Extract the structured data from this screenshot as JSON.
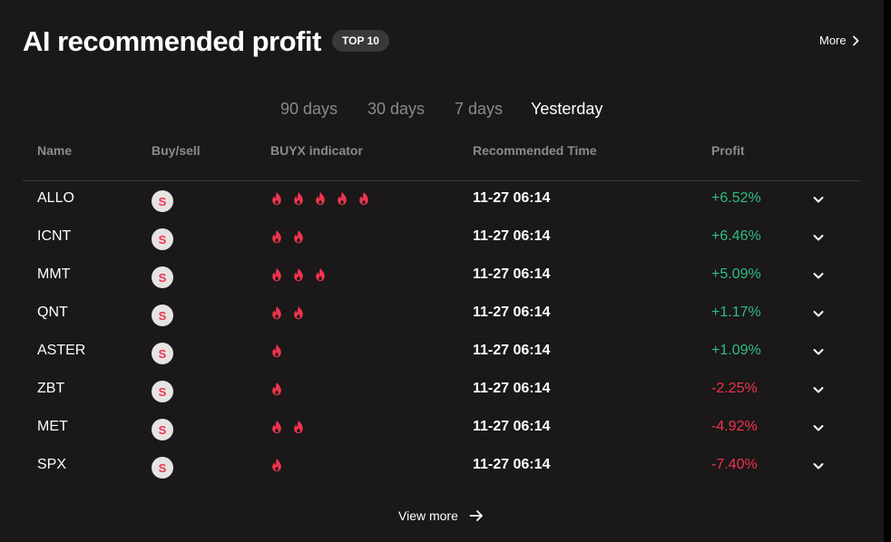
{
  "header": {
    "title": "AI recommended profit",
    "badge": "TOP 10",
    "more_label": "More"
  },
  "tabs": [
    {
      "label": "90 days",
      "active": false
    },
    {
      "label": "30 days",
      "active": false
    },
    {
      "label": "7 days",
      "active": false
    },
    {
      "label": "Yesterday",
      "active": true
    }
  ],
  "columns": {
    "name": "Name",
    "buysell": "Buy/sell",
    "indicator": "BUYX indicator",
    "time": "Recommended Time",
    "profit": "Profit"
  },
  "rows": [
    {
      "name": "ALLO",
      "side": "S",
      "fires": 5,
      "time": "11-27 06:14",
      "profit": "+6.52%",
      "trend": "pos"
    },
    {
      "name": "ICNT",
      "side": "S",
      "fires": 2,
      "time": "11-27 06:14",
      "profit": "+6.46%",
      "trend": "pos"
    },
    {
      "name": "MMT",
      "side": "S",
      "fires": 3,
      "time": "11-27 06:14",
      "profit": "+5.09%",
      "trend": "pos"
    },
    {
      "name": "QNT",
      "side": "S",
      "fires": 2,
      "time": "11-27 06:14",
      "profit": "+1.17%",
      "trend": "pos"
    },
    {
      "name": "ASTER",
      "side": "S",
      "fires": 1,
      "time": "11-27 06:14",
      "profit": "+1.09%",
      "trend": "pos"
    },
    {
      "name": "ZBT",
      "side": "S",
      "fires": 1,
      "time": "11-27 06:14",
      "profit": "-2.25%",
      "trend": "neg"
    },
    {
      "name": "MET",
      "side": "S",
      "fires": 2,
      "time": "11-27 06:14",
      "profit": "-4.92%",
      "trend": "neg"
    },
    {
      "name": "SPX",
      "side": "S",
      "fires": 1,
      "time": "11-27 06:14",
      "profit": "-7.40%",
      "trend": "neg"
    }
  ],
  "footer": {
    "view_more_label": "View more"
  },
  "colors": {
    "background": "#1a1818",
    "positive": "#2ebd85",
    "negative": "#f0334f",
    "fire": "#f0334f"
  },
  "icons": {
    "more": "chevron-right-icon",
    "row_expand": "chevron-down-icon",
    "indicator": "fire-icon",
    "view_more": "arrow-right-icon"
  }
}
